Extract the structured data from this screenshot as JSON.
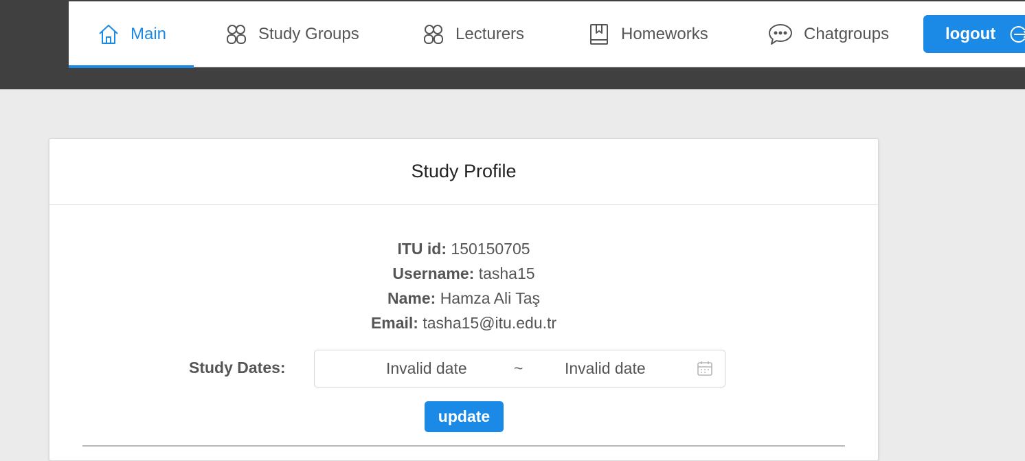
{
  "nav": {
    "items": [
      {
        "label": "Main",
        "icon": "home-icon",
        "active": true
      },
      {
        "label": "Study Groups",
        "icon": "users-icon"
      },
      {
        "label": "Lecturers",
        "icon": "users-icon"
      },
      {
        "label": "Homeworks",
        "icon": "book-icon"
      },
      {
        "label": "Chatgroups",
        "icon": "chat-bubble-icon"
      }
    ],
    "logout_label": "logout",
    "logout_icon": "logout-icon"
  },
  "profile": {
    "title": "Study Profile",
    "fields": [
      {
        "label": "ITU id:",
        "value": "150150705"
      },
      {
        "label": "Username:",
        "value": "tasha15"
      },
      {
        "label": "Name:",
        "value": "Hamza Ali Taş"
      },
      {
        "label": "Email:",
        "value": "tasha15@itu.edu.tr"
      }
    ],
    "dates_label": "Study Dates:",
    "date_start": "Invalid date",
    "date_separator": "~",
    "date_end": "Invalid date",
    "calendar_icon": "calendar-icon",
    "update_label": "update"
  },
  "colors": {
    "accent": "#1b8ae6",
    "topbar": "#404040",
    "page_background": "#ebebeb"
  }
}
